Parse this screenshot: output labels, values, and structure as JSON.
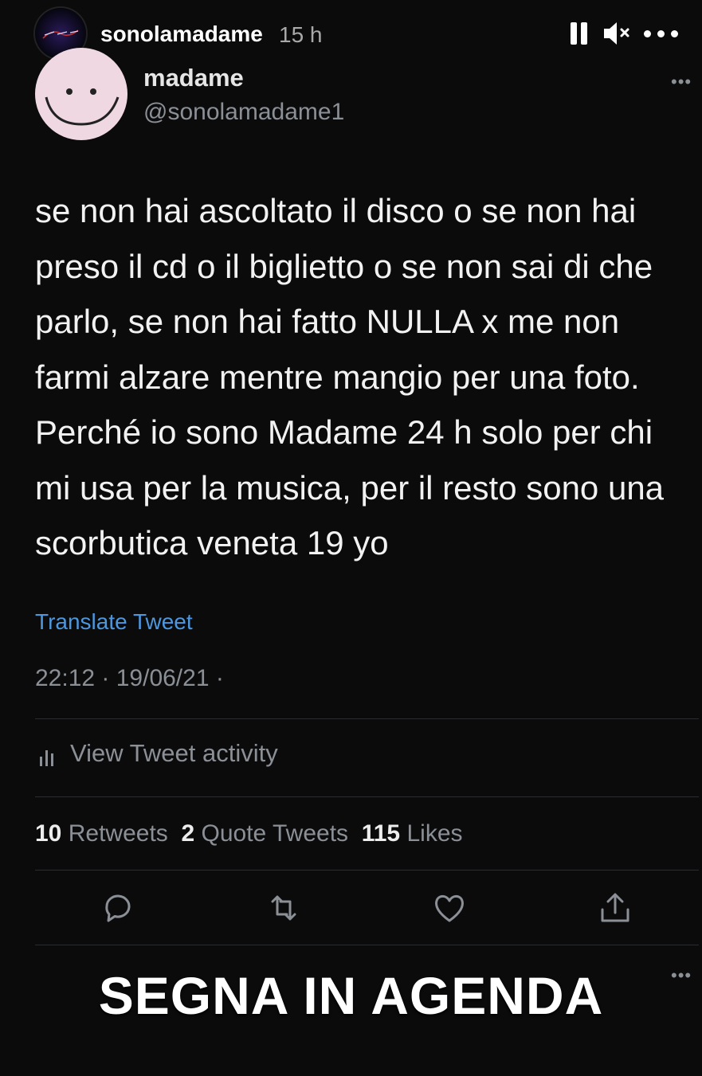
{
  "story": {
    "username": "sonolamadame",
    "time": "15 h"
  },
  "tweet": {
    "display_name": "madame",
    "handle": "@sonolamadame1",
    "text": "se non hai ascoltato il disco o se non hai preso il cd o il biglietto o se non sai di che parlo, se non hai fatto NULLA x me non farmi alzare mentre mangio per una foto. Perché io sono Madame 24 h solo per chi mi usa per la musica, per il resto sono una scorbutica veneta 19 yo",
    "translate_label": "Translate Tweet",
    "timestamp": "22:12 · 19/06/21 ·",
    "activity_label": "View Tweet activity",
    "stats": {
      "retweets_count": "10",
      "retweets_label": "Retweets",
      "quotes_count": "2",
      "quotes_label": "Quote Tweets",
      "likes_count": "115",
      "likes_label": "Likes"
    }
  },
  "overlay": {
    "caption": "SEGNA IN AGENDA"
  },
  "icons": {
    "pause": "pause-icon",
    "mute": "speaker-muted-icon",
    "more": "more-horizontal-icon",
    "reply": "reply-icon",
    "retweet": "retweet-icon",
    "like": "heart-icon",
    "share": "share-icon"
  },
  "colors": {
    "background": "#0b0b0c",
    "link": "#4c97de",
    "secondary_text": "#8b8f96"
  }
}
